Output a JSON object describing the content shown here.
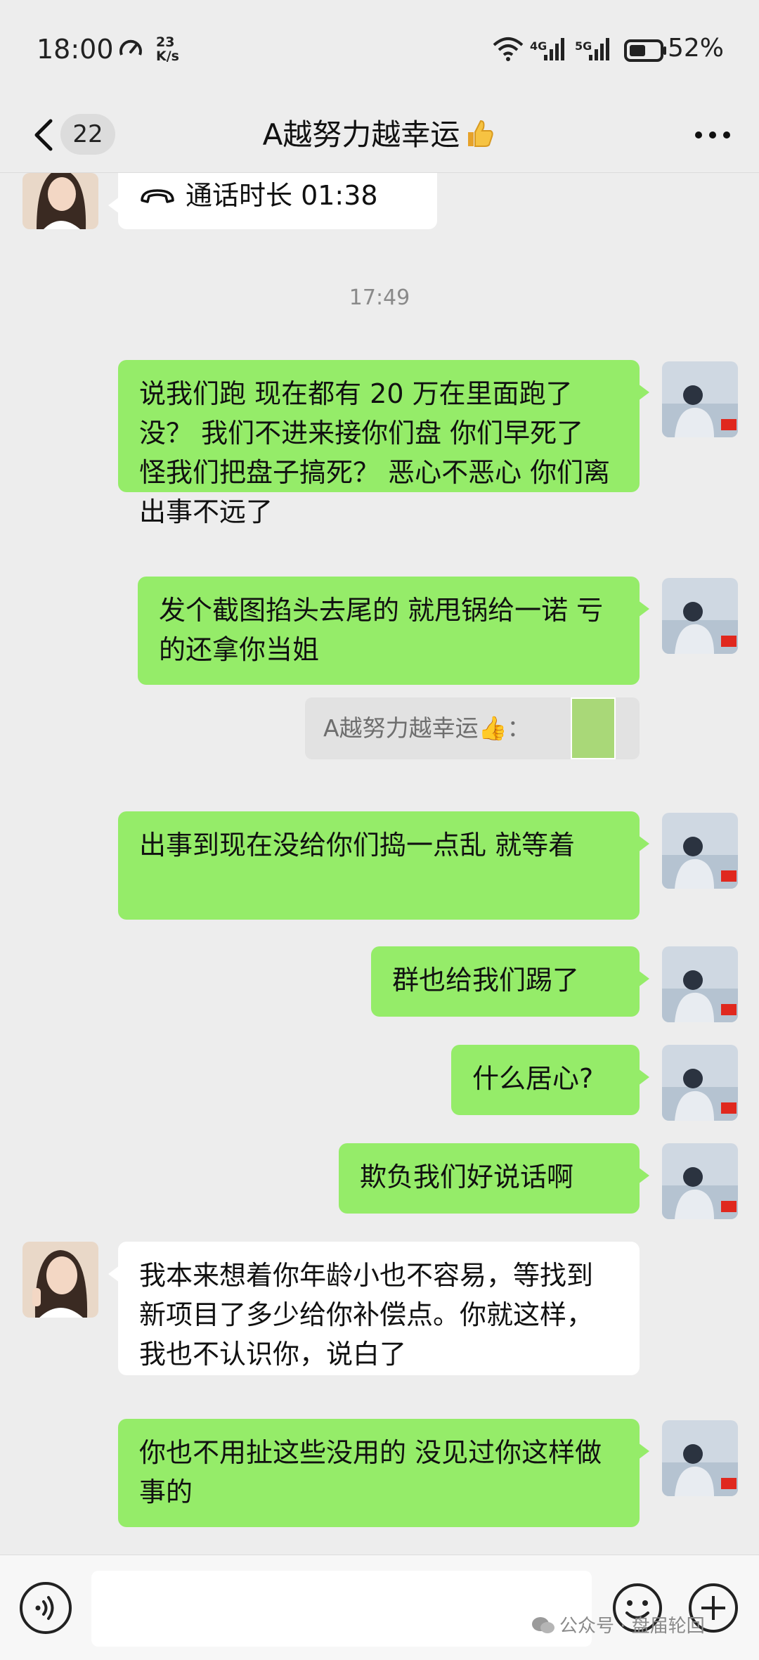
{
  "status_bar": {
    "time": "18:00",
    "net_speed_value": "23",
    "net_speed_unit": "K/s",
    "network_4g": "4G",
    "network_5g": "5G",
    "battery_percent": "52%"
  },
  "nav": {
    "back_icon": "chevron-left-icon",
    "unread_count": "22",
    "title": "A越努力越幸运",
    "title_emoji": "thumbs-up-icon",
    "more_icon": "more-dots-icon"
  },
  "chat": {
    "call_record": {
      "icon": "phone-hangup-icon",
      "text": "通话时长 01:38"
    },
    "timestamp": "17:49",
    "messages": [
      {
        "side": "out",
        "text": "说我们跑  现在都有 20 万在里面跑了没？ 我们不进来接你们盘 你们早死了 怪我们把盘子搞死？  恶心不恶心 你们离出事不远了"
      },
      {
        "side": "out",
        "text": "发个截图掐头去尾的 就甩锅给一诺  亏的还拿你当姐"
      },
      {
        "side": "quote",
        "text": "A越努力越幸运👍："
      },
      {
        "side": "out",
        "text": "出事到现在没给你们捣一点乱   就等着"
      },
      {
        "side": "out",
        "text": "群也给我们踢了"
      },
      {
        "side": "out",
        "text": "什么居心?"
      },
      {
        "side": "out",
        "text": "欺负我们好说话啊"
      },
      {
        "side": "in",
        "text": "我本来想着你年龄小也不容易，等找到新项目了多少给你补偿点。你就这样，我也不认识你，说白了"
      },
      {
        "side": "out",
        "text": "你也不用扯这些没用的   没见过你这样做事的"
      }
    ]
  },
  "input_bar": {
    "voice_icon": "voice-icon",
    "text_value": "",
    "emoji_icon": "emoji-icon",
    "plus_icon": "plus-icon"
  },
  "watermark": {
    "icon": "wechat-icon",
    "text": "公众号 · 盘届轮回"
  },
  "colors": {
    "background": "#ededed",
    "outgoing_bubble": "#95ec69",
    "incoming_bubble": "#ffffff"
  }
}
